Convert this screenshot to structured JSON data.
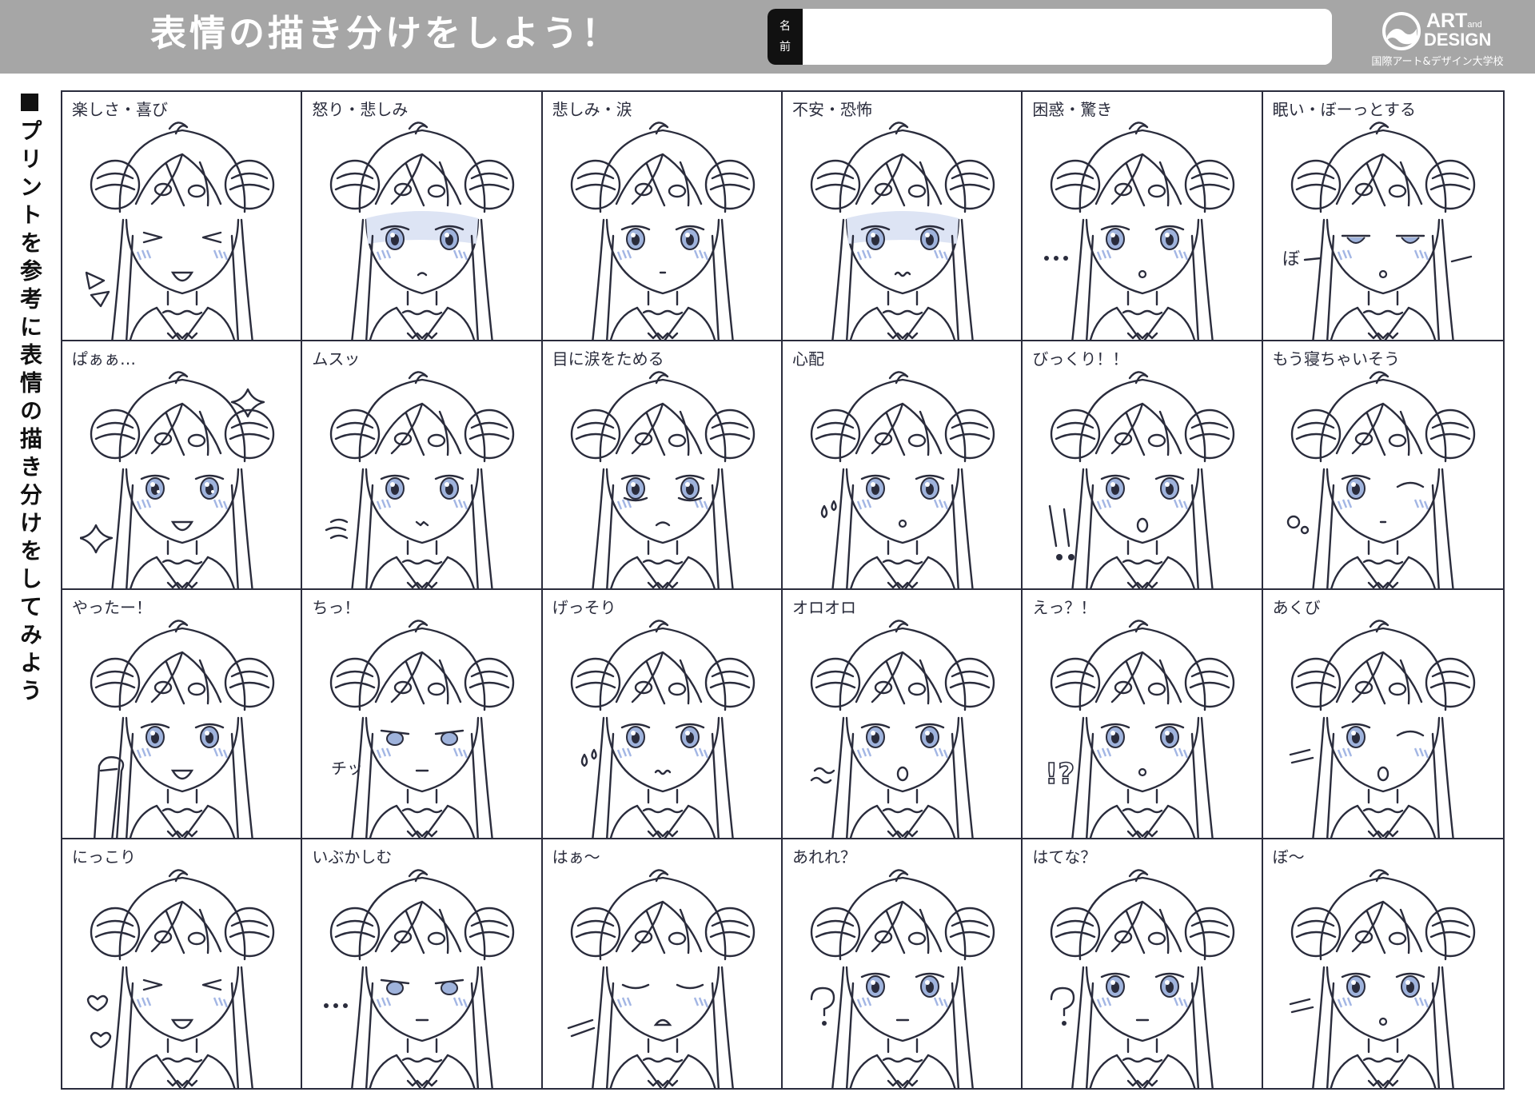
{
  "header": {
    "title": "表情の描き分けをしよう！",
    "name_label": [
      "名",
      "前"
    ],
    "name_value": "",
    "logo": {
      "icon": "circle-swirl-logo-icon",
      "line1": "ART",
      "and": "and",
      "line2": "DESIGN",
      "school": "国際アート&デザイン大学校"
    }
  },
  "side_instruction": "プリントを参考に表情の描き分けをしてみよう",
  "colors": {
    "header_bg": "#a6a6a6",
    "line": "#2a2c3c",
    "eye_blue": "#9fb3dc",
    "shadow_blue": "#dde4f4",
    "blush": "#a3b6e4"
  },
  "expressions": [
    {
      "label": "楽しさ・喜び",
      "eyes": "closed-happy",
      "mouth": "open-smile",
      "effect": "triangle-marks"
    },
    {
      "label": "怒り・悲しみ",
      "eyes": "open",
      "mouth": "small-frown",
      "effect": "shadow"
    },
    {
      "label": "悲しみ・涙",
      "eyes": "open",
      "mouth": "small",
      "effect": "none"
    },
    {
      "label": "不安・恐怖",
      "eyes": "open",
      "mouth": "wavy",
      "effect": "shadow"
    },
    {
      "label": "困惑・驚き",
      "eyes": "open",
      "mouth": "small-open",
      "effect": "dots"
    },
    {
      "label": "眠い・ぼーっとする",
      "eyes": "half",
      "mouth": "small-open",
      "effect": "bo-text"
    },
    {
      "label": "ぱぁぁ…",
      "eyes": "sparkle",
      "mouth": "open-smile",
      "effect": "sparkles"
    },
    {
      "label": "ムスッ",
      "eyes": "open",
      "mouth": "pout",
      "effect": "puff"
    },
    {
      "label": "目に涙をためる",
      "eyes": "teary",
      "mouth": "frown",
      "effect": "none"
    },
    {
      "label": "心配",
      "eyes": "open",
      "mouth": "small-open",
      "effect": "sweat"
    },
    {
      "label": "びっくり！！",
      "eyes": "open",
      "mouth": "open",
      "effect": "exclaim"
    },
    {
      "label": "もう寝ちゃいそう",
      "eyes": "wink",
      "mouth": "small",
      "effect": "bubbles"
    },
    {
      "label": "やったー！",
      "eyes": "open",
      "mouth": "open-smile",
      "effect": "fist"
    },
    {
      "label": "ちっ！",
      "eyes": "narrow",
      "mouth": "flat",
      "effect": "chi-text"
    },
    {
      "label": "げっそり",
      "eyes": "open",
      "mouth": "wavy",
      "effect": "sweat"
    },
    {
      "label": "オロオロ",
      "eyes": "open",
      "mouth": "open",
      "effect": "wiggle"
    },
    {
      "label": "えっ？！",
      "eyes": "open",
      "mouth": "small-open",
      "effect": "exclaim-question"
    },
    {
      "label": "あくび",
      "eyes": "wink",
      "mouth": "open",
      "effect": "lines"
    },
    {
      "label": "にっこり",
      "eyes": "closed-happy",
      "mouth": "open-smile",
      "effect": "hearts"
    },
    {
      "label": "いぶかしむ",
      "eyes": "narrow",
      "mouth": "flat",
      "effect": "dots"
    },
    {
      "label": "はぁ～",
      "eyes": "closed",
      "mouth": "wavy-open",
      "effect": "sigh"
    },
    {
      "label": "あれれ？",
      "eyes": "open",
      "mouth": "flat",
      "effect": "question"
    },
    {
      "label": "はてな？",
      "eyes": "open",
      "mouth": "flat",
      "effect": "question"
    },
    {
      "label": "ぼ～",
      "eyes": "open",
      "mouth": "small-open",
      "effect": "lines"
    }
  ]
}
